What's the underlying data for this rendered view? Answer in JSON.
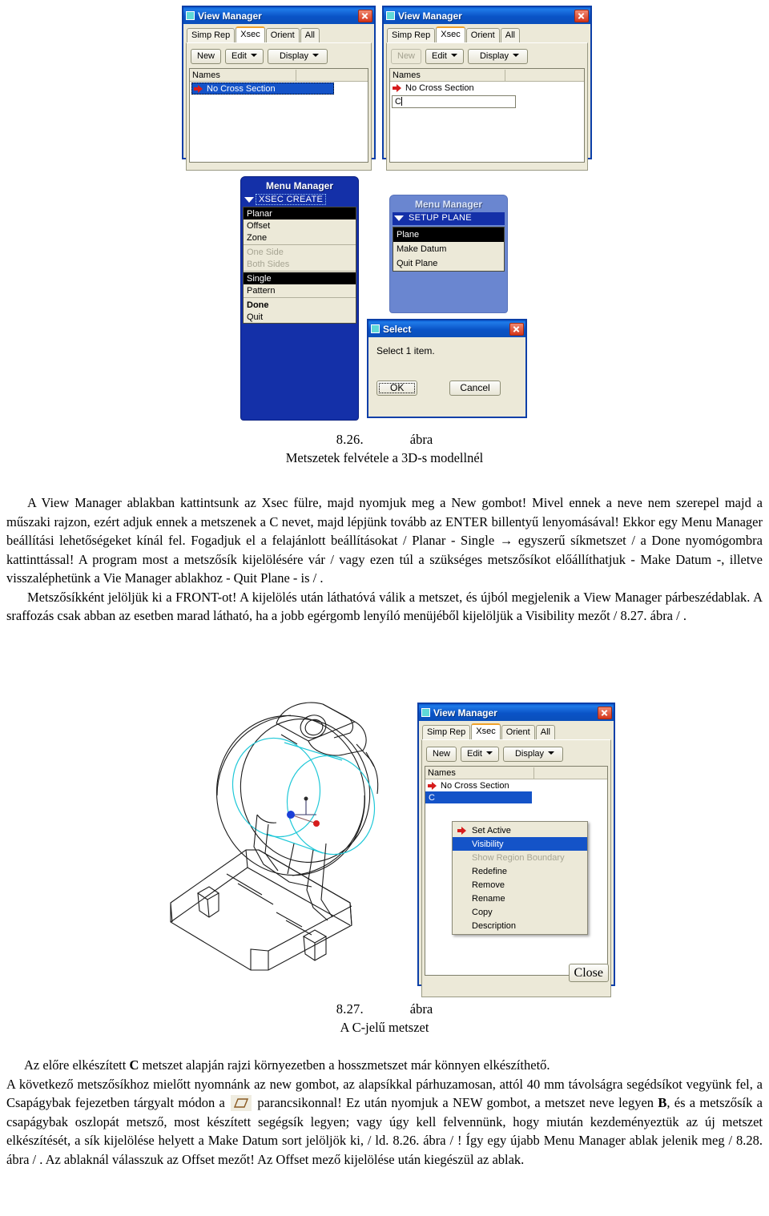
{
  "figure_826": {
    "viewmanager_1": {
      "title": "View Manager",
      "tabs": [
        "Simp Rep",
        "Xsec",
        "Orient",
        "All"
      ],
      "active_tab": "Xsec",
      "buttons": [
        "New",
        "Edit",
        "Display"
      ],
      "list_header": "Names",
      "rows": [
        "No Cross Section"
      ]
    },
    "viewmanager_2": {
      "title": "View Manager",
      "tabs": [
        "Simp Rep",
        "Xsec",
        "Orient",
        "All"
      ],
      "active_tab": "Xsec",
      "buttons": [
        "New",
        "Edit",
        "Display"
      ],
      "new_disabled": true,
      "list_header": "Names",
      "rows": [
        "No Cross Section"
      ],
      "input_value": "C"
    },
    "menu_manager_1": {
      "title": "Menu Manager",
      "header": "XSEC CREATE",
      "items": [
        {
          "label": "Planar",
          "state": "highlight"
        },
        {
          "label": "Offset",
          "state": "normal"
        },
        {
          "label": "Zone",
          "state": "normal"
        },
        {
          "label": "One Side",
          "state": "disabled"
        },
        {
          "label": "Both Sides",
          "state": "disabled"
        },
        {
          "label": "Single",
          "state": "highlight"
        },
        {
          "label": "Pattern",
          "state": "normal"
        },
        {
          "label": "Done",
          "state": "bold"
        },
        {
          "label": "Quit",
          "state": "normal"
        }
      ]
    },
    "menu_manager_2": {
      "title": "Menu Manager",
      "header": "SETUP PLANE",
      "items": [
        {
          "label": "Plane",
          "state": "highlight"
        },
        {
          "label": "Make Datum",
          "state": "normal"
        },
        {
          "label": "Quit Plane",
          "state": "normal"
        }
      ]
    },
    "select_dialog": {
      "title": "Select",
      "message": "Select 1 item.",
      "ok_label": "OK",
      "cancel_label": "Cancel"
    },
    "caption_number": "8.26.",
    "caption_abra": "ábra",
    "caption_text": "Metszetek felvétele a 3D-s modellnél"
  },
  "paragraph_1": {
    "line1": "A View Manager ablakban kattintsunk az Xsec fülre, majd nyomjuk meg a New gombot! Mivel ennek a neve nem szerepel majd a műszaki rajzon, ezért adjuk ennek a metszenek a C nevet, majd lépjünk tovább az ENTER billentyű lenyomásával! Ekkor egy Menu Manager beállítási lehetőségeket kínál fel. Fogadjuk el a felajánlott beállításokat / Planar  - Single → egyszerű síkmetszet / a Done nyomógombra kattinttással! A program most a metszősík kijelölésére vár / vagy ezen túl a szükséges metszősíkot előállíthatjuk - Make Datum -, illetve visszaléphetünk a Vie Manager ablakhoz  - Quit Plane - is / .",
    "line2": "Metszősíkként jelöljük ki a FRONT-ot! A kijelölés után láthatóvá válik a metszet, és újból megjelenik a View Manager párbeszédablak. A sraffozás csak abban az esetben marad látható, ha a jobb egérgomb lenyíló menüjéből kijelöljük a Visibility mezőt / 8.27. ábra / ."
  },
  "figure_827": {
    "viewmanager_3": {
      "title": "View Manager",
      "tabs": [
        "Simp Rep",
        "Xsec",
        "Orient",
        "All"
      ],
      "active_tab": "Xsec",
      "buttons": [
        "New",
        "Edit",
        "Display"
      ],
      "list_header": "Names",
      "rows": [
        "No Cross Section",
        "C"
      ],
      "selected_row": "C",
      "close_label": "Close"
    },
    "context_menu": {
      "items": [
        {
          "label": "Set Active",
          "state": "normal",
          "icon": "red-arrow-icon"
        },
        {
          "label": "Visibility",
          "state": "selected"
        },
        {
          "label": "Show Region Boundary",
          "state": "disabled"
        },
        {
          "label": "Redefine",
          "state": "normal"
        },
        {
          "label": "Remove",
          "state": "normal"
        },
        {
          "label": "Rename",
          "state": "normal"
        },
        {
          "label": "Copy",
          "state": "normal"
        },
        {
          "label": "Description",
          "state": "normal"
        }
      ]
    },
    "caption_number": "8.27.",
    "caption_abra": "ábra",
    "caption_text": "A C-jelű metszet"
  },
  "paragraph_2": {
    "line1_a": "Az előre elkészített ",
    "line1_b": "C",
    "line1_c": " metszet alapján rajzi környezetben a hosszmetszet már könnyen elkészíthető.",
    "line2": "A következő metszősíkhoz mielőtt nyomnánk az new gombot, az alapsíkkal párhuzamosan, attól 40 mm távolságra segédsíkot vegyünk fel, a Csapágybak fejezetben tárgyalt módon a ",
    "line2_icon": "datum-plane-icon",
    "line2_after": " parancsikonnal! Ez után nyomjuk a NEW gombot, a metszet neve legyen ",
    "line2_bold": "B",
    "line2_tail": ", és a metszősík a csapágybak oszlopát metsző, most készített segégsík legyen; vagy úgy kell felvennünk, hogy miután kezdeményeztük az új metszet elkészítését, a sík kijelölése helyett a Make Datum sort jelöljök ki, / ld. 8.26. ábra / ! Így egy újabb Menu Manager ablak jelenik meg / 8.28. ábra / . Az ablaknál válasszuk az Offset mezőt! Az Offset mező kijelölése után kiegészül az ablak."
  },
  "colors": {
    "title_bar_blue": "#0a53c6",
    "dialog_face": "#ece9d8",
    "selection_blue": "#1453c8",
    "active_tab_orange": "#f0a22a",
    "arrow_red": "#d61c1c",
    "menu_blue": "#1430a8",
    "model_cyan": "#20c8d8",
    "model_black": "#1a1a1a"
  }
}
